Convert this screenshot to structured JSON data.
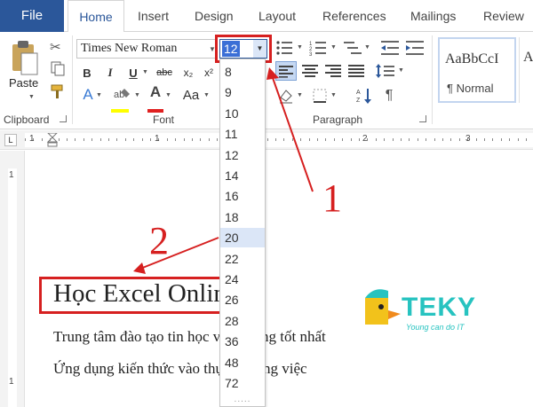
{
  "tabs": {
    "file": "File",
    "home": "Home",
    "insert": "Insert",
    "design": "Design",
    "layout": "Layout",
    "references": "References",
    "mailings": "Mailings",
    "review": "Review"
  },
  "clipboard": {
    "paste_label": "Paste",
    "group_label": "Clipboard"
  },
  "font": {
    "group_label": "Font",
    "name": "Times New Roman",
    "size": "12",
    "bold": "B",
    "italic": "I",
    "underline": "U",
    "strike": "abc",
    "subscript": "x₂",
    "superscript": "x²",
    "text_effects": "A",
    "font_color": "A",
    "change_case": "Aa",
    "grow": "A",
    "shrink": "A",
    "highlight_color": "#ffff00",
    "font_color_value": "#e02020"
  },
  "paragraph": {
    "group_label": "Paragraph",
    "pilcrow": "¶"
  },
  "styles": {
    "preview": "AaBbCcI",
    "name": "¶ Normal"
  },
  "ruler": {
    "numbers": [
      "1",
      "1",
      "2",
      "3"
    ]
  },
  "font_size_list": {
    "items": [
      "8",
      "9",
      "10",
      "11",
      "12",
      "14",
      "16",
      "18",
      "20",
      "22",
      "24",
      "26",
      "28",
      "36",
      "48",
      "72"
    ],
    "hovered": "20",
    "grip": "....."
  },
  "document": {
    "title": "Học Excel Online",
    "line1": "Trung tâm đào tạo tin học văn phòng tốt nhất",
    "line2": "Ứng dụng kiến thức vào thực tế công việc"
  },
  "annotations": {
    "step1": "1",
    "step2": "2",
    "color": "#d62020"
  },
  "logo": {
    "text": "TEKY",
    "tagline": "Young can do IT",
    "color": "#27c3c0"
  }
}
